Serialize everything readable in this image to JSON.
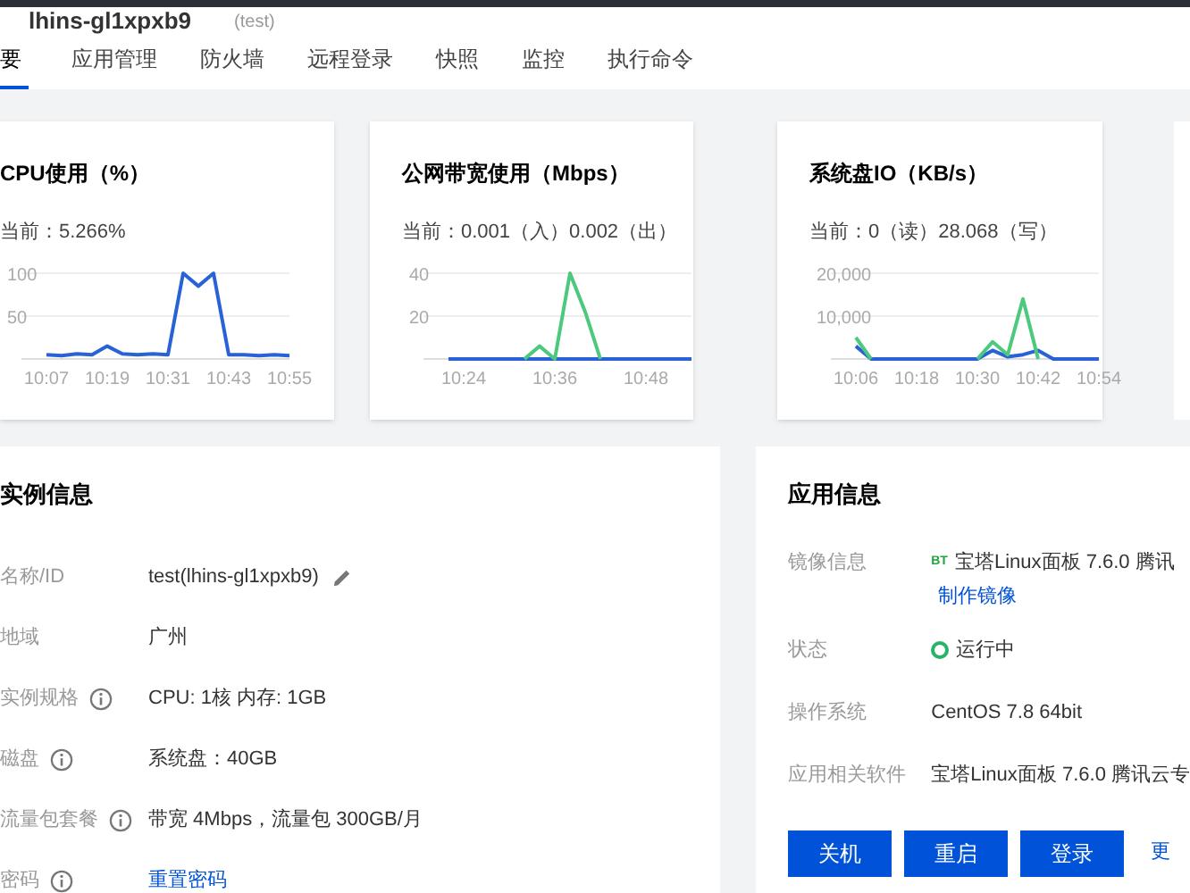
{
  "header": {
    "title": "lhins-gl1xpxb9",
    "subtitle": "(test)"
  },
  "tabs": [
    {
      "label": "要",
      "selected": true
    },
    {
      "label": "应用管理",
      "selected": false
    },
    {
      "label": "防火墙",
      "selected": false
    },
    {
      "label": "远程登录",
      "selected": false
    },
    {
      "label": "快照",
      "selected": false
    },
    {
      "label": "监控",
      "selected": false
    },
    {
      "label": "执行命令",
      "selected": false
    }
  ],
  "monitor_cards": [
    {
      "title": "CPU使用（%）",
      "current": "当前：5.266%",
      "chart_data": {
        "type": "line",
        "categories": [
          "10:07",
          null,
          null,
          null,
          "10:19",
          null,
          null,
          null,
          "10:31",
          null,
          null,
          null,
          "10:43",
          null,
          null,
          null,
          "10:55"
        ],
        "series": [
          {
            "color": "#2962d6",
            "values": [
              5,
              4,
              6,
              5,
              15,
              6,
              5,
              6,
              5,
              100,
              85,
              100,
              5,
              5,
              4,
              5,
              4
            ]
          }
        ],
        "ylim": [
          0,
          100
        ],
        "yticks": [
          {
            "value": 50,
            "label": "50"
          },
          {
            "value": 100,
            "label": "100"
          }
        ]
      }
    },
    {
      "title": "公网带宽使用（Mbps）",
      "current": "当前：0.001（入）0.002（出）",
      "chart_data": {
        "type": "line",
        "categories": [
          null,
          "10:24",
          null,
          null,
          null,
          null,
          null,
          "10:36",
          null,
          null,
          null,
          null,
          null,
          "10:48",
          null,
          null,
          null
        ],
        "series": [
          {
            "color": "#2962d6",
            "values": [
              0,
              0,
              0,
              0,
              0,
              0,
              0,
              0,
              0,
              0,
              0,
              0,
              0,
              0,
              0,
              0,
              0
            ]
          },
          {
            "color": "#4cc97d",
            "values": [
              null,
              null,
              null,
              null,
              null,
              0,
              6,
              0,
              40,
              22,
              0,
              null,
              null,
              null,
              null,
              null,
              null
            ]
          }
        ],
        "ylim": [
          0,
          40
        ],
        "yticks": [
          {
            "value": 20,
            "label": "20"
          },
          {
            "value": 40,
            "label": "40"
          }
        ]
      }
    },
    {
      "title": "系统盘IO（KB/s）",
      "current": "当前：0（读）28.068（写）",
      "chart_data": {
        "type": "line",
        "categories": [
          "10:06",
          null,
          null,
          null,
          "10:18",
          null,
          null,
          null,
          "10:30",
          null,
          null,
          null,
          "10:42",
          null,
          null,
          null,
          "10:54"
        ],
        "series": [
          {
            "color": "#2962d6",
            "values": [
              3000,
              0,
              0,
              0,
              0,
              0,
              0,
              0,
              0,
              2000,
              500,
              1000,
              2000,
              0,
              0,
              0,
              0
            ]
          },
          {
            "color": "#4cc97d",
            "values": [
              5000,
              0,
              null,
              null,
              null,
              null,
              null,
              null,
              0,
              4000,
              1000,
              14000,
              0,
              null,
              null,
              null,
              null
            ]
          }
        ],
        "ylim": [
          0,
          20000
        ],
        "yticks": [
          {
            "value": 10000,
            "label": "10,000"
          },
          {
            "value": 20000,
            "label": "20,000"
          }
        ]
      }
    }
  ],
  "instance_info": {
    "title": "实例信息",
    "rows": [
      {
        "label": "名称/ID",
        "value": "test(lhins-gl1xpxb9)",
        "kind": "editable",
        "info": false
      },
      {
        "label": "地域",
        "value": "广州",
        "kind": "text",
        "info": false
      },
      {
        "label": "实例规格",
        "value": "CPU: 1核 内存: 1GB",
        "kind": "text",
        "info": true
      },
      {
        "label": "磁盘",
        "value": "系统盘：40GB",
        "kind": "text",
        "info": true
      },
      {
        "label": "流量包套餐",
        "value": "带宽 4Mbps，流量包 300GB/月",
        "kind": "text",
        "info": true
      },
      {
        "label": "密码",
        "value": "重置密码",
        "kind": "link",
        "info": true
      }
    ]
  },
  "app_info": {
    "title": "应用信息",
    "image": {
      "label": "镜像信息",
      "logo_text": "BT",
      "value": "宝塔Linux面板 7.6.0 腾讯",
      "link": "制作镜像"
    },
    "status": {
      "label": "状态",
      "value": "运行中",
      "color": "#29b36a"
    },
    "os": {
      "label": "操作系统",
      "value": "CentOS 7.8 64bit"
    },
    "software": {
      "label": "应用相关软件",
      "value": "宝塔Linux面板 7.6.0 腾讯云专"
    },
    "buttons": [
      "关机",
      "重启",
      "登录"
    ],
    "more": "更"
  }
}
